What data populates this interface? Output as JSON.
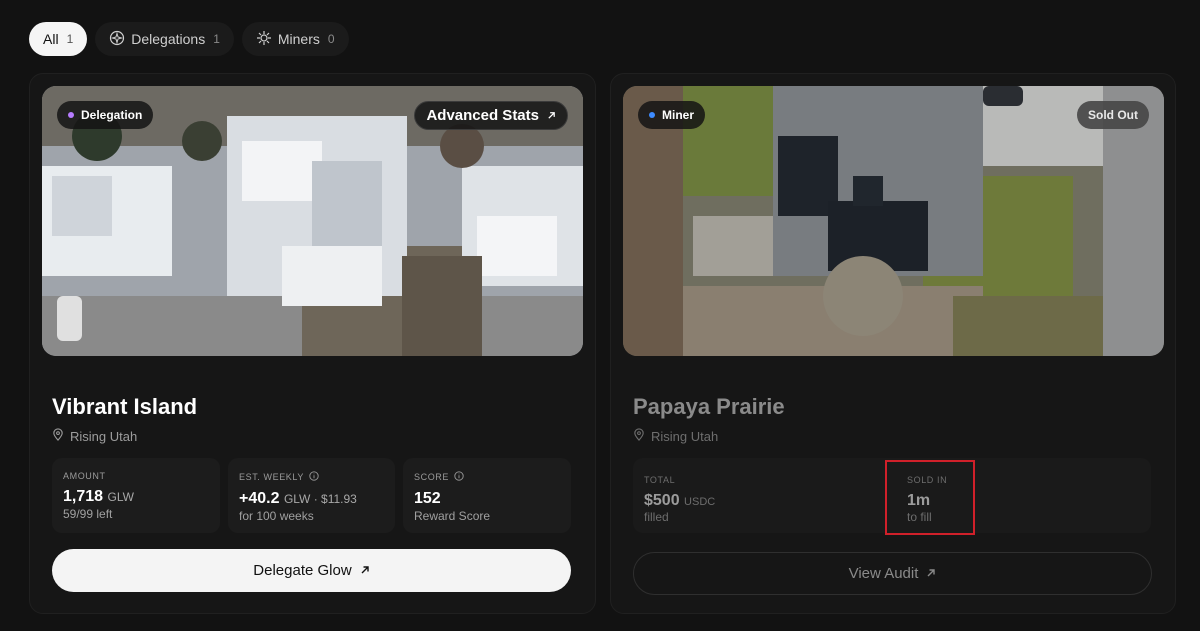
{
  "tabs": [
    {
      "label": "All",
      "count": "1",
      "active": true
    },
    {
      "label": "Delegations",
      "count": "1",
      "icon": "delegation-icon"
    },
    {
      "label": "Miners",
      "count": "0",
      "icon": "miner-gear-icon"
    }
  ],
  "cards": [
    {
      "type_badge": "Delegation",
      "badge_dot_color": "#b67cff",
      "top_right_button": "Advanced Stats",
      "title": "Vibrant Island",
      "location": "Rising Utah",
      "stats": [
        {
          "label": "AMOUNT",
          "value": "1,718",
          "unit": "GLW",
          "sub": "59/99 left"
        },
        {
          "label": "EST. WEEKLY",
          "value": "+40.2",
          "unit": "GLW · $11.93",
          "sub": "for 100 weeks"
        },
        {
          "label": "SCORE",
          "value": "152",
          "unit": "",
          "sub": "Reward Score"
        }
      ],
      "action": "Delegate Glow"
    },
    {
      "type_badge": "Miner",
      "badge_dot_color": "#3d8bff",
      "status_badge": "Sold Out",
      "title": "Papaya Prairie",
      "location": "Rising Utah",
      "stats": [
        {
          "label": "TOTAL",
          "value": "$500",
          "unit": "USDC",
          "sub": "filled"
        },
        {
          "label": "SOLD IN",
          "value": "1m",
          "unit": "",
          "sub": "to fill"
        }
      ],
      "action": "View Audit"
    }
  ]
}
